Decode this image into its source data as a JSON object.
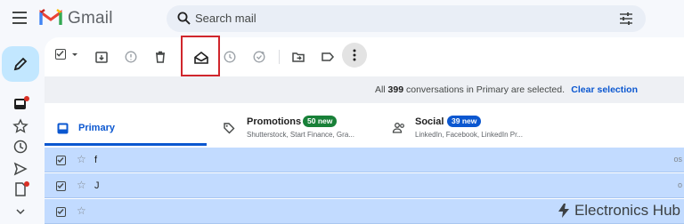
{
  "app": {
    "name": "Gmail"
  },
  "search": {
    "placeholder": "Search mail"
  },
  "toolbar": {
    "icons": [
      "select-checkbox-icon",
      "archive-icon",
      "report-spam-icon",
      "delete-icon",
      "mark-as-read-icon",
      "snooze-icon",
      "add-to-tasks-icon",
      "move-to-icon",
      "label-icon",
      "more-vert-icon"
    ]
  },
  "banner": {
    "prefix": "All",
    "count": "399",
    "suffix": "conversations in Primary are selected.",
    "clear_label": "Clear selection"
  },
  "tabs": [
    {
      "label": "Primary"
    },
    {
      "label": "Promotions",
      "badge": "50 new",
      "snippet": "Shutterstock, Start Finance, Gra..."
    },
    {
      "label": "Social",
      "badge": "39 new",
      "snippet": "LinkedIn, Facebook, LinkedIn Pr..."
    }
  ],
  "rows": [
    {
      "sender": "f",
      "tail": "os"
    },
    {
      "sender": "J",
      "tail": "o"
    },
    {
      "sender": "",
      "tail": ""
    }
  ],
  "watermark": "Electronics Hub",
  "colors": {
    "accent": "#0b57d0",
    "selected_row": "#c2dbff",
    "highlight_box": "#d0262c",
    "promo_badge": "#188038",
    "social_badge": "#0b57d0"
  }
}
